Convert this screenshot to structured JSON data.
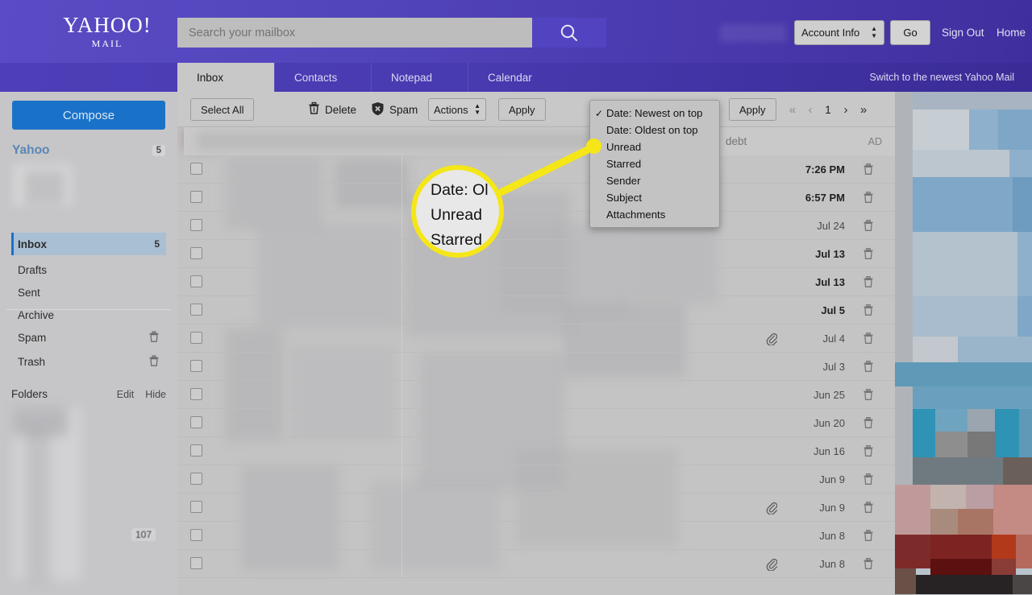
{
  "header": {
    "logo_main": "YAHOO!",
    "logo_sub": "MAIL",
    "search_placeholder": "Search your mailbox",
    "search_value": "",
    "search_icon": "search-icon",
    "account_select_value": "Account Info",
    "go_label": "Go",
    "sign_out_label": "Sign Out",
    "home_label": "Home"
  },
  "tabs": [
    {
      "label": "Inbox",
      "active": true
    },
    {
      "label": "Contacts",
      "active": false
    },
    {
      "label": "Notepad",
      "active": false
    },
    {
      "label": "Calendar",
      "active": false
    }
  ],
  "switch_link": "Switch to the newest Yahoo Mail",
  "sidebar": {
    "compose_label": "Compose",
    "account_name": "Yahoo",
    "account_badge": "5",
    "folders": [
      {
        "label": "Inbox",
        "count": "5",
        "selected": true,
        "trash": false
      },
      {
        "label": "Drafts",
        "count": "",
        "selected": false,
        "trash": false
      },
      {
        "label": "Sent",
        "count": "",
        "selected": false,
        "trash": false
      },
      {
        "label": "Archive",
        "count": "",
        "selected": false,
        "trash": false
      },
      {
        "label": "Spam",
        "count": "",
        "selected": false,
        "trash": true
      },
      {
        "label": "Trash",
        "count": "",
        "selected": false,
        "trash": true
      }
    ],
    "folders_header": "Folders",
    "folders_edit": "Edit",
    "folders_hide": "Hide",
    "folder_count_107": "107"
  },
  "toolbar": {
    "select_all_label": "Select All",
    "delete_label": "Delete",
    "delete_icon": "trash-icon",
    "spam_label": "Spam",
    "spam_icon": "spam-shield-icon",
    "actions_value": "Actions",
    "apply_label": "Apply",
    "apply2_label": "Apply",
    "pager": {
      "first": "«",
      "prev": "‹",
      "page": "1",
      "next": "›",
      "last": "»"
    }
  },
  "sort_menu": {
    "items": [
      {
        "label": "Date: Newest on top",
        "checked": true
      },
      {
        "label": "Date: Oldest on top",
        "checked": false
      },
      {
        "label": "Unread",
        "checked": false
      },
      {
        "label": "Starred",
        "checked": false
      },
      {
        "label": "Sender",
        "checked": false
      },
      {
        "label": "Subject",
        "checked": false
      },
      {
        "label": "Attachments",
        "checked": false
      }
    ]
  },
  "magnifier": {
    "line1": "Date: Ol",
    "line2": "Unread",
    "line3": "Starred",
    "ring_color": "#f5e617"
  },
  "ad_row": {
    "text": "debt",
    "tag": "AD"
  },
  "mail_rows": [
    {
      "date": "7:26 PM",
      "unread": true,
      "attachment": false
    },
    {
      "date": "6:57 PM",
      "unread": true,
      "attachment": false
    },
    {
      "date": "Jul 24",
      "unread": false,
      "attachment": false
    },
    {
      "date": "Jul 13",
      "unread": true,
      "attachment": false
    },
    {
      "date": "Jul 13",
      "unread": true,
      "attachment": false
    },
    {
      "date": "Jul 5",
      "unread": true,
      "attachment": false
    },
    {
      "date": "Jul 4",
      "unread": false,
      "attachment": true
    },
    {
      "date": "Jul 3",
      "unread": false,
      "attachment": false
    },
    {
      "date": "Jun 25",
      "unread": false,
      "attachment": false
    },
    {
      "date": "Jun 20",
      "unread": false,
      "attachment": false
    },
    {
      "date": "Jun 16",
      "unread": false,
      "attachment": false
    },
    {
      "date": "Jun 9",
      "unread": false,
      "attachment": false
    },
    {
      "date": "Jun 9",
      "unread": false,
      "attachment": true
    },
    {
      "date": "Jun 8",
      "unread": false,
      "attachment": false
    },
    {
      "date": "Jun 8",
      "unread": false,
      "attachment": true
    }
  ],
  "colors": {
    "header_purple": "#5244c0",
    "compose_blue": "#1a72c8",
    "highlight_yellow": "#f5e617",
    "panel_gray": "#c8c8c8",
    "selected_folder": "#a9bfd4"
  }
}
